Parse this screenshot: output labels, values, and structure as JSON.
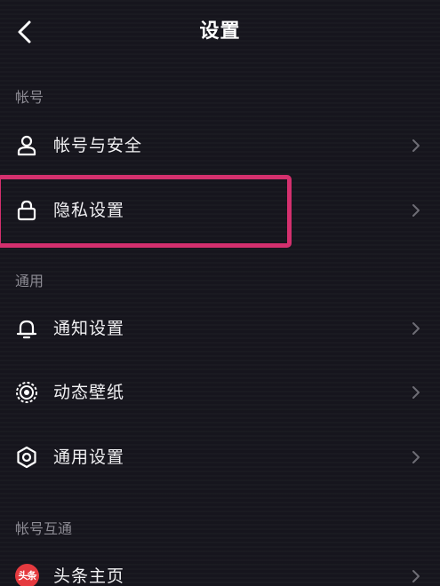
{
  "header": {
    "title": "设置",
    "back_icon": "chevron-left-icon"
  },
  "sections": [
    {
      "label": "帐号",
      "items": [
        {
          "label": "帐号与安全",
          "icon": "person-icon"
        },
        {
          "label": "隐私设置",
          "icon": "lock-icon",
          "highlighted": true
        }
      ]
    },
    {
      "label": "通用",
      "items": [
        {
          "label": "通知设置",
          "icon": "bell-icon"
        },
        {
          "label": "动态壁纸",
          "icon": "live-wallpaper-icon"
        },
        {
          "label": "通用设置",
          "icon": "gear-icon"
        }
      ]
    },
    {
      "label": "帐号互通",
      "items": [
        {
          "label": "头条主页",
          "icon": "toutiao-logo-icon",
          "badge_text": "头条"
        }
      ]
    }
  ],
  "colors": {
    "background": "#16151d",
    "highlight_border": "#d4306e",
    "section_label": "#8c8b93",
    "chevron": "#6e6d75",
    "toutiao_red": "#e53a3f"
  }
}
